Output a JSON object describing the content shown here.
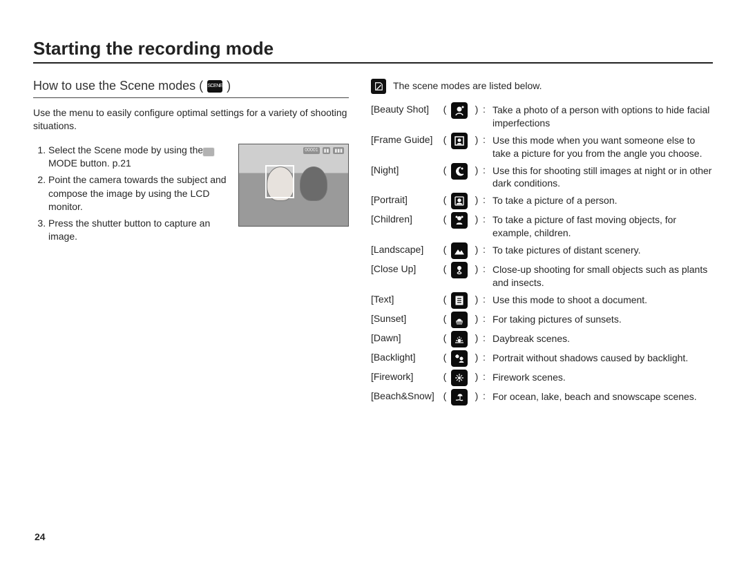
{
  "title": "Starting the recording mode",
  "section": {
    "heading_prefix": "How to use the Scene modes (",
    "heading_suffix": ")",
    "lead": "Use the menu to easily configure optimal settings for a variety of shooting situations.",
    "steps": [
      "Select the Scene mode by using the MODE button. p.21",
      "Point the camera towards the subject and compose the image by using the LCD monitor.",
      "Press the shutter button to capture an image."
    ]
  },
  "note": "The scene modes are listed below.",
  "modes": [
    {
      "name": "[Beauty Shot]",
      "icon": "beauty",
      "desc": "Take a photo of a person with options to hide facial imperfections"
    },
    {
      "name": "[Frame Guide]",
      "icon": "frame",
      "desc": "Use this mode when you want someone else to take a picture for you from the angle you choose."
    },
    {
      "name": "[Night]",
      "icon": "night",
      "desc": "Use this for shooting still images at night or in other dark conditions."
    },
    {
      "name": "[Portrait]",
      "icon": "portrait",
      "desc": "To take a picture of a person."
    },
    {
      "name": "[Children]",
      "icon": "children",
      "desc": "To take a picture of fast moving objects, for example, children."
    },
    {
      "name": "[Landscape]",
      "icon": "landscape",
      "desc": "To take pictures of distant scenery."
    },
    {
      "name": "[Close Up]",
      "icon": "closeup",
      "desc": "Close-up shooting for small objects such as plants and insects."
    },
    {
      "name": "[Text]",
      "icon": "text",
      "desc": "Use this mode to shoot a document."
    },
    {
      "name": "[Sunset]",
      "icon": "sunset",
      "desc": "For taking pictures of sunsets."
    },
    {
      "name": "[Dawn]",
      "icon": "dawn",
      "desc": "Daybreak scenes."
    },
    {
      "name": "[Backlight]",
      "icon": "backlight",
      "desc": "Portrait without shadows caused by backlight."
    },
    {
      "name": "[Firework]",
      "icon": "firework",
      "desc": "Firework scenes."
    },
    {
      "name": "[Beach&Snow]",
      "icon": "beach",
      "desc": "For ocean, lake, beach and snowscape scenes."
    }
  ],
  "page_number": "24",
  "colon": ":",
  "open_paren": "(",
  "close_paren": ")"
}
